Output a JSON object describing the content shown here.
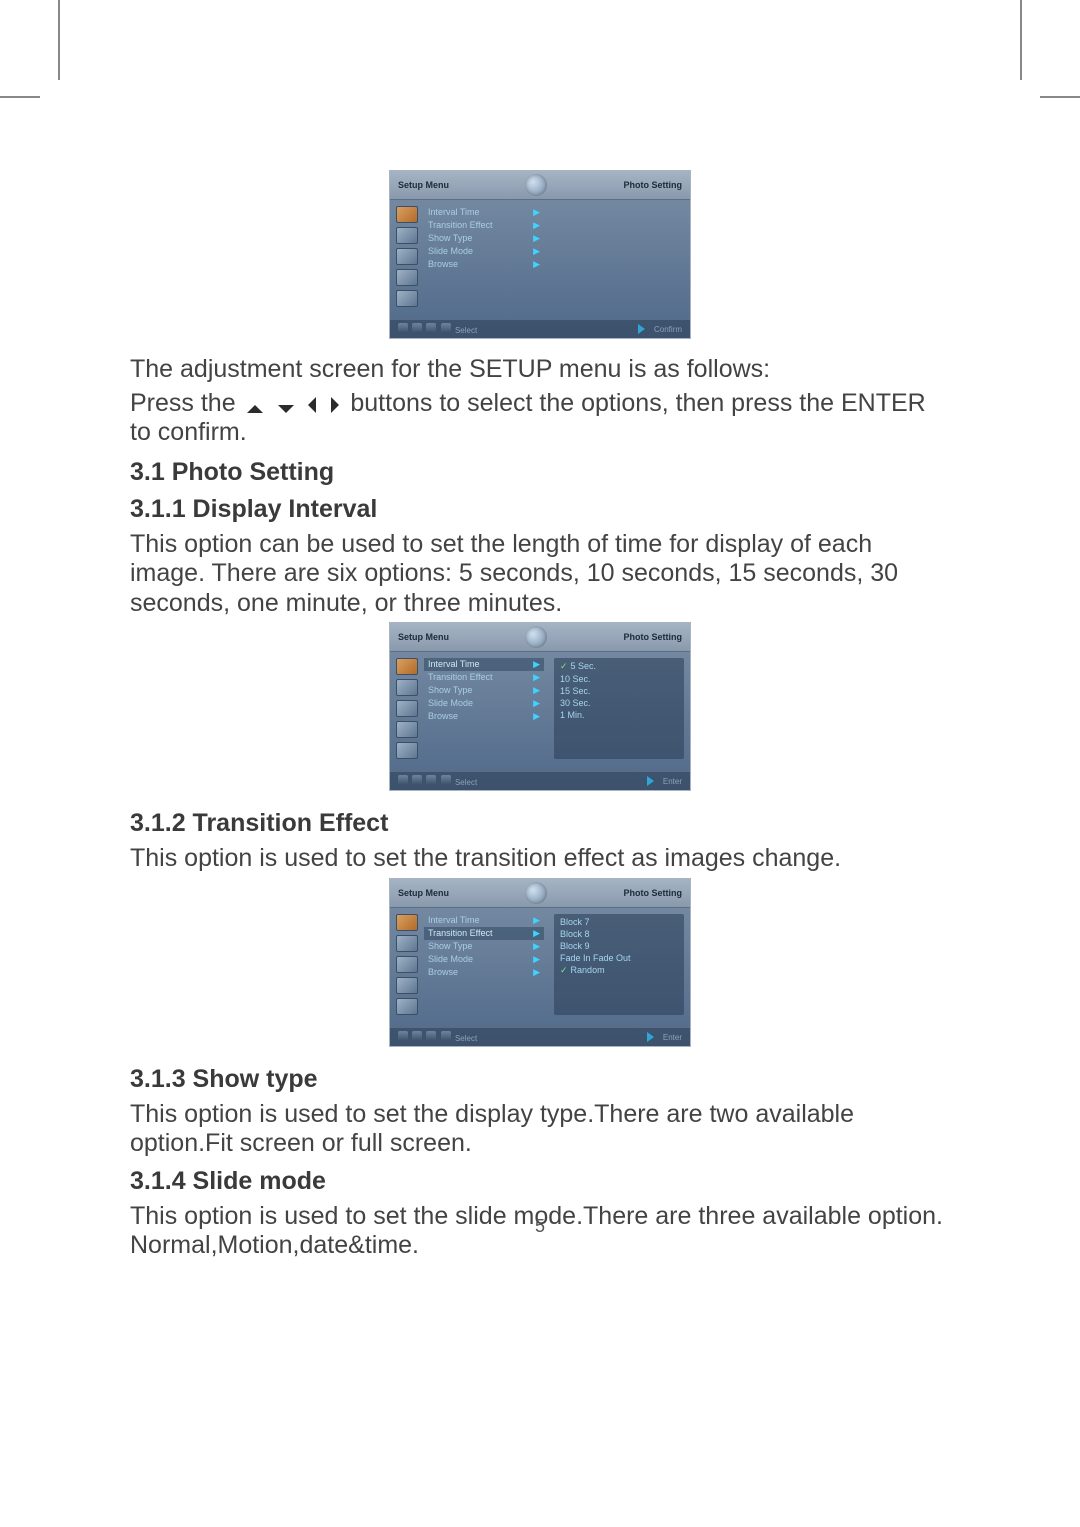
{
  "text": {
    "adjustment_line": "The adjustment screen for the SETUP menu is as follows:",
    "press_line_a": "Press the",
    "press_line_b": "buttons to select the options, then press the ENTER to confirm.",
    "h31": "3.1 Photo Setting",
    "h311": "3.1.1 Display Interval",
    "p311": "This option can be used to set the length of time for display of each image. There are six options: 5 seconds, 10 seconds, 15 seconds, 30 seconds, one minute, or three minutes.",
    "h312": "3.1.2 Transition Effect",
    "p312": "This option is used to set the transition effect as images change.",
    "h313": "3.1.3 Show type",
    "p313": "This option is used to set the display type.There are two available option.Fit screen or full screen.",
    "h314": "3.1.4 Slide mode",
    "p314": "This option is used to set the slide mode.There are three available option. Normal,Motion,date&time.",
    "page_number": "5"
  },
  "screenshots": {
    "common": {
      "title_left": "Setup Menu",
      "title_right": "Photo Setting",
      "menu": [
        "Interval Time",
        "Transition Effect",
        "Show Type",
        "Slide Mode",
        "Browse"
      ],
      "footer_select": "Select",
      "footer_confirm": "Confirm",
      "footer_enter": "Enter"
    },
    "shot1": {
      "selected_index": -1,
      "values": []
    },
    "shot2": {
      "selected_index": 0,
      "values": [
        "5 Sec.",
        "10 Sec.",
        "15 Sec.",
        "30 Sec.",
        "1 Min."
      ],
      "checked_index": 0
    },
    "shot3": {
      "selected_index": 1,
      "values": [
        "Block 7",
        "Block 8",
        "Block 9",
        "Fade In Fade Out",
        "Random"
      ],
      "checked_index": 4
    }
  }
}
